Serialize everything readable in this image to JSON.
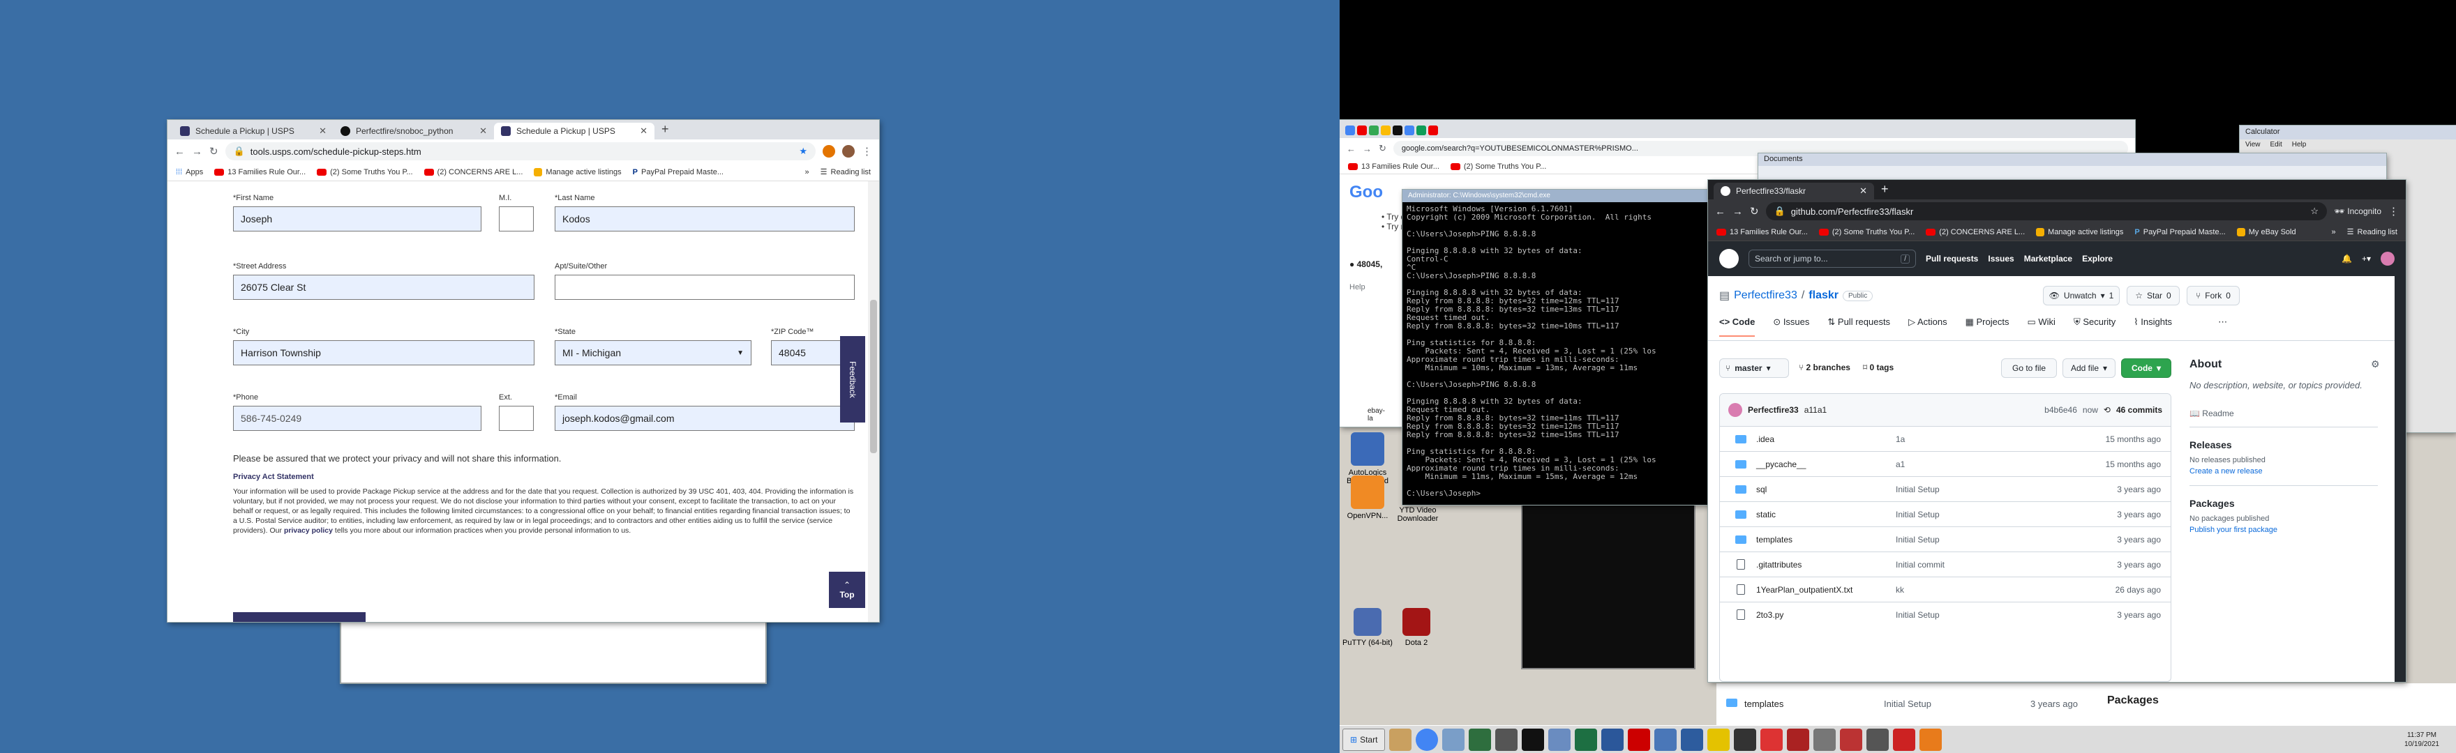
{
  "usps": {
    "tabs": [
      {
        "label": "Schedule a Pickup | USPS"
      },
      {
        "label": "Perfectfire/snoboc_python"
      },
      {
        "label": "Schedule a Pickup | USPS"
      }
    ],
    "url": "tools.usps.com/schedule-pickup-steps.htm",
    "bookmarks": [
      "Apps",
      "13 Families Rule Our...",
      "(2) Some Truths You P...",
      "(2) CONCERNS ARE L...",
      "Manage active listings",
      "PayPal Prepaid Maste..."
    ],
    "reading_list": "Reading list",
    "form": {
      "first_name_label": "*First Name",
      "first_name": "Joseph",
      "mi_label": "M.I.",
      "mi": "",
      "last_name_label": "*Last Name",
      "last_name": "Kodos",
      "street_label": "*Street Address",
      "street": "26075 Clear St",
      "apt_label": "Apt/Suite/Other",
      "apt": "",
      "city_label": "*City",
      "city": "Harrison Township",
      "state_label": "*State",
      "state": "MI - Michigan",
      "zip_label": "*ZIP Code™",
      "zip": "48045",
      "phone_label": "*Phone",
      "phone": "586-745-0249",
      "ext_label": "Ext.",
      "ext": "",
      "email_label": "*Email",
      "email": "joseph.kodos@gmail.com"
    },
    "privacy_note": "Please be assured that we protect your privacy and will not share this information.",
    "privacy_heading": "Privacy Act Statement",
    "privacy_body": "Your information will be used to provide Package Pickup service at the address and for the date that you request. Collection is authorized by 39 USC 401, 403, 404. Providing the information is voluntary, but if not provided, we may not process your request. We do not disclose your information to third parties without your consent, except to facilitate the transaction, to act on your behalf or request, or as legally required. This includes the following limited circumstances: to a congressional office on your behalf; to financial entities regarding financial transaction issues; to a U.S. Postal Service auditor; to entities, including law enforcement, as required by law or in legal proceedings; and to contractors and other entities aiding us to fulfill the service (service providers). Our",
    "privacy_link": "privacy policy",
    "privacy_tail": "tells you more about our information practices when you provide personal information to us.",
    "feedback": "Feedback",
    "top": "Top"
  },
  "chrome_back": {
    "url": "google.com/search?q=YOUTUBESEMICOLONMASTER%PRISMO...",
    "bookmarks": [
      "13 Families Rule Our...",
      "(2) Some Truths You P..."
    ],
    "snippet1": "Try di",
    "snippet2": "Try m",
    "zip": "48045,",
    "help": "Help",
    "ebay": "ebay-la"
  },
  "cmd": {
    "title": "Administrator: C:\\Windows\\system32\\cmd.exe",
    "text": "Microsoft Windows [Version 6.1.7601]\nCopyright (c) 2009 Microsoft Corporation.  All rights\n\nC:\\Users\\Joseph>PING 8.8.8.8\n\nPinging 8.8.8.8 with 32 bytes of data:\nControl-C\n^C\nC:\\Users\\Joseph>PING 8.8.8.8\n\nPinging 8.8.8.8 with 32 bytes of data:\nReply from 8.8.8.8: bytes=32 time=12ms TTL=117\nReply from 8.8.8.8: bytes=32 time=13ms TTL=117\nRequest timed out.\nReply from 8.8.8.8: bytes=32 time=10ms TTL=117\n\nPing statistics for 8.8.8.8:\n    Packets: Sent = 4, Received = 3, Lost = 1 (25% los\nApproximate round trip times in milli-seconds:\n    Minimum = 10ms, Maximum = 13ms, Average = 11ms\n\nC:\\Users\\Joseph>PING 8.8.8.8\n\nPinging 8.8.8.8 with 32 bytes of data:\nRequest timed out.\nReply from 8.8.8.8: bytes=32 time=11ms TTL=117\nReply from 8.8.8.8: bytes=32 time=12ms TTL=117\nReply from 8.8.8.8: bytes=32 time=15ms TTL=117\n\nPing statistics for 8.8.8.8:\n    Packets: Sent = 4, Received = 3, Lost = 1 (25% los\nApproximate round trip times in milli-seconds:\n    Minimum = 11ms, Maximum = 15ms, Average = 12ms\n\nC:\\Users\\Joseph>"
  },
  "github": {
    "tab": "Perfectfire33/flaskr",
    "url": "github.com/Perfectfire33/flaskr",
    "incognito": "Incognito",
    "bookmarks": [
      "13 Families Rule Our...",
      "(2) Some Truths You P...",
      "(2) CONCERNS ARE L...",
      "Manage active listings",
      "PayPal Prepaid Maste...",
      "My eBay Sold"
    ],
    "reading_list": "Reading list",
    "search": "Search or jump to...",
    "nav": [
      "Pull requests",
      "Issues",
      "Marketplace",
      "Explore"
    ],
    "owner": "Perfectfire33",
    "repo": "flaskr",
    "visibility": "Public",
    "unwatch": "Unwatch",
    "watch_count": "1",
    "star": "Star",
    "star_count": "0",
    "fork": "Fork",
    "fork_count": "0",
    "tabs": [
      "Code",
      "Issues",
      "Pull requests",
      "Actions",
      "Projects",
      "Wiki",
      "Security",
      "Insights"
    ],
    "branch": "master",
    "branches": "2 branches",
    "tags": "0 tags",
    "goto": "Go to file",
    "addfile": "Add file",
    "code": "Code",
    "commit_user": "Perfectfire33",
    "commit_msg": "a11a1",
    "commit_hash": "b4b6e46",
    "commit_time": "now",
    "commits": "46 commits",
    "files": [
      {
        "name": ".idea",
        "type": "dir",
        "msg": "1a",
        "time": "15 months ago"
      },
      {
        "name": "__pycache__",
        "type": "dir",
        "msg": "a1",
        "time": "15 months ago"
      },
      {
        "name": "sql",
        "type": "dir",
        "msg": "Initial Setup",
        "time": "3 years ago"
      },
      {
        "name": "static",
        "type": "dir",
        "msg": "Initial Setup",
        "time": "3 years ago"
      },
      {
        "name": "templates",
        "type": "dir",
        "msg": "Initial Setup",
        "time": "3 years ago"
      },
      {
        "name": ".gitattributes",
        "type": "file",
        "msg": "Initial commit",
        "time": "3 years ago"
      },
      {
        "name": "1YearPlan_outpatientX.txt",
        "type": "file",
        "msg": "kk",
        "time": "26 days ago"
      },
      {
        "name": "2to3.py",
        "type": "file",
        "msg": "Initial Setup",
        "time": "3 years ago"
      }
    ],
    "about_h": "About",
    "about_t": "No description, website, or topics provided.",
    "readme": "Readme",
    "releases_h": "Releases",
    "releases_t": "No releases published",
    "releases_l": "Create a new release",
    "packages_h": "Packages",
    "packages_t": "No packages published",
    "packages_l": "Publish your first package"
  },
  "behind": {
    "row_name": "templates",
    "row_msg": "Initial Setup",
    "row_time": "3 years ago",
    "packages": "Packages"
  },
  "calculator": {
    "title": "Calculator",
    "menu": [
      "View",
      "Edit",
      "Help"
    ]
  },
  "docwin": {
    "title": "Documents"
  },
  "desktop_icons": [
    {
      "label": "AutoLogics BoostSpeed"
    },
    {
      "label": "OpenVPN..."
    },
    {
      "label": "YTD Video Downloader"
    },
    {
      "label": "PuTTY (64-bit)"
    },
    {
      "label": "Dota 2"
    }
  ],
  "taskbar": {
    "start": "Start",
    "time": "11:37 PM",
    "date": "10/19/2021"
  }
}
